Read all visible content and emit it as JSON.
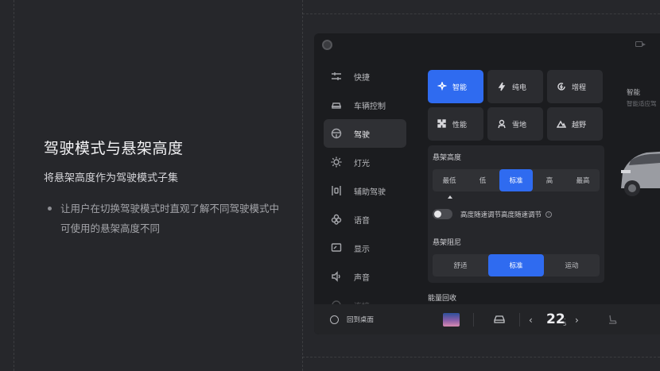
{
  "slide": {
    "title": "驾驶模式与悬架高度",
    "subtitle": "将悬架高度作为驾驶模式子集",
    "bullet": "让用户在切换驾驶模式时直观了解不同驾驶模式中可使用的悬架高度不同"
  },
  "nav": {
    "items": [
      {
        "label": "快捷",
        "icon": "sliders-icon"
      },
      {
        "label": "车辆控制",
        "icon": "car-icon"
      },
      {
        "label": "驾驶",
        "icon": "steering-wheel-icon",
        "active": true
      },
      {
        "label": "灯光",
        "icon": "sun-icon"
      },
      {
        "label": "辅助驾驶",
        "icon": "lane-icon"
      },
      {
        "label": "语音",
        "icon": "flower-icon"
      },
      {
        "label": "显示",
        "icon": "display-icon"
      },
      {
        "label": "声音",
        "icon": "speaker-icon"
      },
      {
        "label": "连接",
        "icon": "link-icon"
      }
    ]
  },
  "modes": [
    {
      "label": "智能",
      "icon": "sparkle-car-icon",
      "selected": true
    },
    {
      "label": "纯电",
      "icon": "bolt-icon"
    },
    {
      "label": "增程",
      "icon": "refresh-bolt-icon"
    },
    {
      "label": "性能",
      "icon": "checker-flag-icon"
    },
    {
      "label": "雪地",
      "icon": "snow-car-icon"
    },
    {
      "label": "越野",
      "icon": "mountain-icon"
    }
  ],
  "suspension": {
    "height_label": "悬架高度",
    "height_options": [
      "最低",
      "低",
      "标准",
      "高",
      "最高"
    ],
    "height_selected": "标准",
    "toggle_label": "高度随速调节高度随速调节",
    "toggle_on": false,
    "info_glyph": "i",
    "damping_label": "悬架阻尼",
    "damping_options": [
      "舒适",
      "标准",
      "运动"
    ],
    "damping_selected": "标准",
    "energy_label": "能量回收"
  },
  "preview": {
    "title": "智能",
    "subtitle": "智能适应驾"
  },
  "bottom_bar": {
    "home_label": "回到桌面",
    "temperature_int": "22",
    "temperature_dec_top": ".",
    "temperature_dec": "5",
    "prev_glyph": "‹",
    "next_glyph": "›"
  },
  "colors": {
    "accent": "#2f6bf0",
    "background": "#26272b",
    "screen": "#1b1c1f"
  }
}
